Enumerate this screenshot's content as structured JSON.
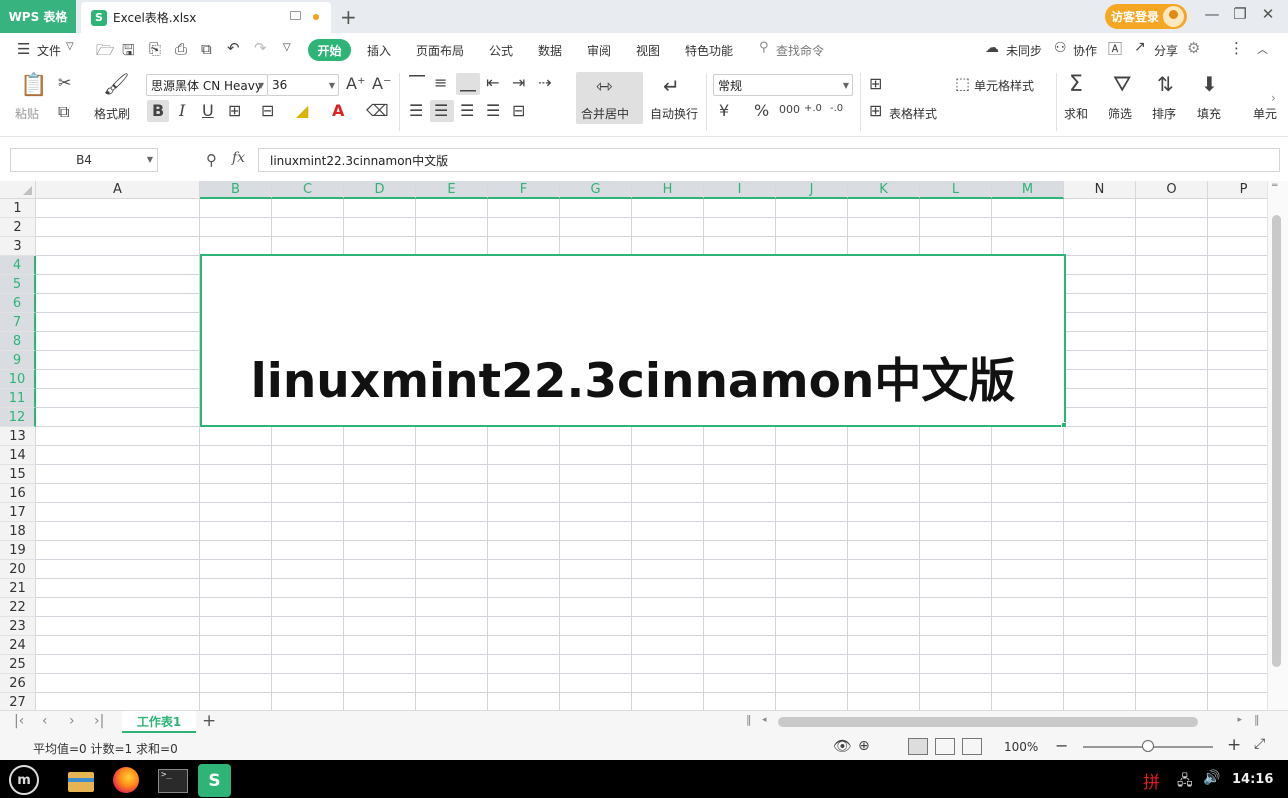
{
  "titlebar": {
    "app_badge": "WPS 表格",
    "tab_icon_letter": "S",
    "tab_name": "Excel表格.xlsx",
    "login_label": "访客登录"
  },
  "menu": {
    "file_label": "文件",
    "start_label": "开始",
    "items": [
      "插入",
      "页面布局",
      "公式",
      "数据",
      "审阅",
      "视图",
      "特色功能"
    ],
    "search_label": "查找命令",
    "right_items": [
      "未同步",
      "协作",
      "分享"
    ]
  },
  "ribbon": {
    "paste": "粘贴",
    "format_painter": "格式刷",
    "font_name": "思源黑体 CN Heavy",
    "font_size": "36",
    "bold": "B",
    "italic": "I",
    "underline": "U",
    "merge_center": "合并居中",
    "wrap_text": "自动换行",
    "number_format": "常规",
    "currency": "¥",
    "percent": "%",
    "thousands": "000",
    "decimal_inc": "+.0",
    "decimal_dec": "-.0",
    "cell_style": "单元格样式",
    "table_style": "表格样式",
    "sum": "求和",
    "filter": "筛选",
    "sort": "排序",
    "fill": "填充",
    "cells": "单元"
  },
  "formula": {
    "name_box": "B4",
    "fx": "fx",
    "content": "linuxmint22.3cinnamon中文版"
  },
  "sheet": {
    "columns": [
      "A",
      "B",
      "C",
      "D",
      "E",
      "F",
      "G",
      "H",
      "I",
      "J",
      "K",
      "L",
      "M",
      "N",
      "O",
      "P"
    ],
    "selected_columns": [
      "B",
      "C",
      "D",
      "E",
      "F",
      "G",
      "H",
      "I",
      "J",
      "K",
      "L",
      "M"
    ],
    "rows": [
      "1",
      "2",
      "3",
      "4",
      "5",
      "6",
      "7",
      "8",
      "9",
      "10",
      "11",
      "12",
      "13",
      "14",
      "15",
      "16",
      "17",
      "18",
      "19",
      "20",
      "21",
      "22",
      "23",
      "24",
      "25",
      "26",
      "27"
    ],
    "selected_rows": [
      "4",
      "5",
      "6",
      "7",
      "8",
      "9",
      "10",
      "11",
      "12"
    ],
    "merged_text": "linuxmint22.3cinnamon中文版",
    "tab_name": "工作表1"
  },
  "status": {
    "summary": "平均值=0  计数=1  求和=0",
    "zoom": "100%"
  },
  "taskbar": {
    "wps_letter": "S",
    "ime": "拼",
    "clock": "14:16"
  },
  "colors": {
    "accent": "#2db476",
    "login": "#f5a623"
  }
}
